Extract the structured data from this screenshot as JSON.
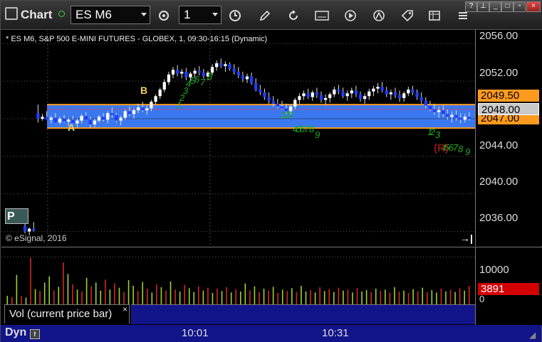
{
  "toolbar": {
    "title": "Chart",
    "symbol": "ES M6",
    "interval": "1"
  },
  "chart": {
    "header": "* ES M6, S&P 500 E-MINI FUTURES - GLOBEX, 1, 09:30-16:15 (Dynamic)",
    "copyright": "© eSignal, 2016",
    "marker_a": "A",
    "marker_b": "B",
    "marker_r": "(R)",
    "p_box": "P",
    "seq_labels": [
      "1",
      "2",
      "3",
      "4",
      "5",
      "6",
      "7",
      "8",
      "1",
      "2",
      "3",
      "4",
      "5",
      "6",
      "7",
      "8",
      "9",
      "1",
      "2",
      "3",
      "4",
      "5",
      "6",
      "7",
      "8",
      "9"
    ],
    "colors": {
      "band": "#3a78f0",
      "band_edge": "#ff9a1f",
      "up_candle": "#ffffff",
      "down_candle": "#1e3cff",
      "seq": "#1faa1f",
      "vol_up": "#9bd23a",
      "vol_down": "#d32828",
      "last_tag": "#d40000"
    },
    "candles": [
      [
        2036.6,
        2036.9,
        2035.8,
        2036.0
      ],
      [
        2036.0,
        2036.4,
        2035.6,
        2036.3
      ],
      [
        2036.3,
        2037.0,
        2036.0,
        2036.1
      ],
      [
        2048.6,
        2049.5,
        2047.6,
        2048.0
      ],
      [
        2048.0,
        2048.5,
        2047.8,
        2048.2
      ],
      [
        2048.2,
        2048.8,
        2047.9,
        2047.9
      ],
      [
        2047.9,
        2048.3,
        2047.5,
        2048.1
      ],
      [
        2048.1,
        2048.6,
        2047.8,
        2047.6
      ],
      [
        2047.6,
        2048.2,
        2047.4,
        2048.0
      ],
      [
        2048.0,
        2048.4,
        2047.6,
        2047.7
      ],
      [
        2047.7,
        2048.1,
        2047.2,
        2047.9
      ],
      [
        2047.9,
        2048.3,
        2047.4,
        2047.5
      ],
      [
        2047.5,
        2048.0,
        2047.1,
        2047.8
      ],
      [
        2047.8,
        2048.5,
        2047.5,
        2048.3
      ],
      [
        2048.3,
        2048.7,
        2047.9,
        2047.9
      ],
      [
        2047.9,
        2048.2,
        2047.0,
        2047.4
      ],
      [
        2047.4,
        2048.0,
        2047.1,
        2047.8
      ],
      [
        2047.8,
        2048.4,
        2047.6,
        2048.2
      ],
      [
        2048.2,
        2048.6,
        2047.7,
        2047.9
      ],
      [
        2047.9,
        2048.8,
        2047.5,
        2048.6
      ],
      [
        2048.6,
        2049.2,
        2048.1,
        2048.4
      ],
      [
        2048.4,
        2048.6,
        2047.6,
        2047.8
      ],
      [
        2047.8,
        2048.3,
        2047.3,
        2048.1
      ],
      [
        2048.1,
        2049.0,
        2047.9,
        2048.8
      ],
      [
        2048.8,
        2049.3,
        2048.3,
        2048.5
      ],
      [
        2048.5,
        2049.1,
        2048.0,
        2048.9
      ],
      [
        2048.9,
        2049.6,
        2048.6,
        2049.2
      ],
      [
        2049.2,
        2049.8,
        2048.7,
        2048.9
      ],
      [
        2048.9,
        2049.4,
        2048.4,
        2049.1
      ],
      [
        2049.1,
        2050.0,
        2048.8,
        2049.8
      ],
      [
        2049.8,
        2050.6,
        2049.5,
        2050.4
      ],
      [
        2050.4,
        2051.3,
        2050.1,
        2051.1
      ],
      [
        2051.1,
        2052.2,
        2050.8,
        2051.9
      ],
      [
        2051.9,
        2053.0,
        2051.6,
        2052.7
      ],
      [
        2052.7,
        2053.5,
        2052.3,
        2053.2
      ],
      [
        2053.2,
        2053.7,
        2052.5,
        2052.8
      ],
      [
        2052.8,
        2053.3,
        2052.3,
        2053.0
      ],
      [
        2053.0,
        2053.4,
        2052.1,
        2052.4
      ],
      [
        2052.4,
        2053.0,
        2052.0,
        2052.8
      ],
      [
        2052.8,
        2053.4,
        2052.4,
        2053.1
      ],
      [
        2053.1,
        2053.6,
        2052.6,
        2052.9
      ],
      [
        2052.9,
        2053.3,
        2052.3,
        2052.5
      ],
      [
        2052.5,
        2053.1,
        2052.1,
        2052.9
      ],
      [
        2052.9,
        2053.8,
        2052.6,
        2053.5
      ],
      [
        2053.5,
        2054.2,
        2053.1,
        2053.9
      ],
      [
        2053.9,
        2054.4,
        2053.4,
        2053.6
      ],
      [
        2053.6,
        2054.1,
        2053.0,
        2053.8
      ],
      [
        2053.8,
        2054.0,
        2053.1,
        2053.3
      ],
      [
        2053.3,
        2053.8,
        2052.7,
        2053.0
      ],
      [
        2053.0,
        2053.5,
        2052.3,
        2052.6
      ],
      [
        2052.6,
        2053.0,
        2051.9,
        2052.2
      ],
      [
        2052.2,
        2052.8,
        2051.8,
        2052.5
      ],
      [
        2052.5,
        2052.9,
        2051.6,
        2051.8
      ],
      [
        2051.8,
        2052.3,
        2050.9,
        2051.1
      ],
      [
        2051.1,
        2051.6,
        2050.5,
        2050.8
      ],
      [
        2050.8,
        2051.2,
        2050.0,
        2050.3
      ],
      [
        2050.3,
        2050.8,
        2049.6,
        2049.9
      ],
      [
        2049.9,
        2050.4,
        2049.3,
        2049.6
      ],
      [
        2049.6,
        2050.1,
        2049.1,
        2049.3
      ],
      [
        2049.3,
        2049.9,
        2049.0,
        2049.1
      ],
      [
        2049.1,
        2049.6,
        2048.5,
        2048.8
      ],
      [
        2048.8,
        2049.5,
        2048.4,
        2049.3
      ],
      [
        2049.3,
        2050.2,
        2049.0,
        2050.0
      ],
      [
        2050.0,
        2050.7,
        2049.6,
        2050.4
      ],
      [
        2050.4,
        2051.0,
        2050.0,
        2050.7
      ],
      [
        2050.7,
        2051.2,
        2050.1,
        2050.3
      ],
      [
        2050.3,
        2051.0,
        2049.9,
        2050.8
      ],
      [
        2050.8,
        2051.3,
        2050.2,
        2050.5
      ],
      [
        2050.5,
        2050.9,
        2049.7,
        2050.0
      ],
      [
        2050.0,
        2050.6,
        2049.5,
        2050.2
      ],
      [
        2050.2,
        2050.8,
        2049.7,
        2050.6
      ],
      [
        2050.6,
        2051.4,
        2050.3,
        2051.1
      ],
      [
        2051.1,
        2051.6,
        2050.6,
        2050.9
      ],
      [
        2050.9,
        2051.3,
        2050.2,
        2050.4
      ],
      [
        2050.4,
        2051.0,
        2049.9,
        2050.7
      ],
      [
        2050.7,
        2051.3,
        2050.2,
        2051.0
      ],
      [
        2051.0,
        2051.5,
        2050.3,
        2050.6
      ],
      [
        2050.6,
        2050.9,
        2049.8,
        2050.1
      ],
      [
        2050.1,
        2050.7,
        2049.6,
        2050.4
      ],
      [
        2050.4,
        2051.2,
        2050.0,
        2050.9
      ],
      [
        2050.9,
        2051.5,
        2050.4,
        2051.2
      ],
      [
        2051.2,
        2051.8,
        2050.7,
        2051.4
      ],
      [
        2051.4,
        2051.9,
        2050.8,
        2051.0
      ],
      [
        2051.0,
        2051.4,
        2050.3,
        2050.6
      ],
      [
        2050.6,
        2051.1,
        2050.0,
        2050.8
      ],
      [
        2050.8,
        2051.3,
        2050.2,
        2050.5
      ],
      [
        2050.5,
        2051.0,
        2049.8,
        2050.2
      ],
      [
        2050.2,
        2050.9,
        2049.8,
        2050.7
      ],
      [
        2050.7,
        2051.4,
        2050.4,
        2051.1
      ],
      [
        2051.1,
        2051.5,
        2050.5,
        2050.8
      ],
      [
        2050.8,
        2051.1,
        2050.0,
        2050.3
      ],
      [
        2050.3,
        2050.8,
        2049.6,
        2049.9
      ],
      [
        2049.9,
        2050.3,
        2049.1,
        2049.4
      ],
      [
        2049.4,
        2049.9,
        2048.8,
        2049.0
      ],
      [
        2049.0,
        2049.6,
        2048.4,
        2048.7
      ],
      [
        2048.7,
        2049.3,
        2048.1,
        2048.9
      ],
      [
        2048.9,
        2049.4,
        2048.2,
        2048.5
      ],
      [
        2048.5,
        2049.0,
        2047.9,
        2048.2
      ],
      [
        2048.2,
        2048.8,
        2047.6,
        2048.4
      ],
      [
        2048.4,
        2048.9,
        2047.8,
        2048.1
      ],
      [
        2048.1,
        2048.6,
        2047.5,
        2047.9
      ],
      [
        2047.9,
        2048.5,
        2047.6,
        2048.2
      ],
      [
        2048.2,
        2048.7,
        2047.8,
        2048.0
      ]
    ],
    "volumes": [
      1800,
      1500,
      6200,
      1700,
      1400,
      9800,
      3200,
      2800,
      4600,
      5900,
      2900,
      3700,
      8800,
      6400,
      4200,
      3100,
      2700,
      5600,
      3800,
      4600,
      2900,
      5200,
      3100,
      4400,
      3500,
      2600,
      5100,
      3900,
      2800,
      4700,
      3300,
      2500,
      4200,
      3600,
      2900,
      4800,
      3100,
      2700,
      4100,
      3400,
      2600,
      3800,
      2900,
      3500,
      2400,
      3300,
      2800,
      3600,
      2500,
      3200,
      2700,
      4400,
      2900,
      3800,
      2600,
      3300,
      2900,
      3700,
      2400,
      3100,
      2800,
      3400,
      2600,
      3900,
      2700,
      3000,
      2500,
      3600,
      2800,
      3200,
      2600,
      3500,
      2900,
      3100,
      2500,
      3400,
      2700,
      3000,
      2600,
      3300,
      2800,
      3100,
      2500,
      3600,
      2700,
      2900,
      2400,
      3200,
      2800,
      3500,
      2600,
      3000,
      2500,
      3300,
      2700,
      3100,
      2600,
      3400,
      2900,
      3891
    ],
    "vol_up": [
      1,
      0,
      1,
      0,
      1,
      0,
      1,
      0,
      1,
      1,
      0,
      1,
      0,
      1,
      0,
      1,
      0,
      1,
      0,
      1,
      1,
      0,
      1,
      0,
      1,
      0,
      1,
      1,
      0,
      1,
      0,
      1,
      0,
      1,
      0,
      1,
      0,
      1,
      0,
      1,
      1,
      0,
      1,
      0,
      1,
      0,
      1,
      0,
      1,
      0,
      1,
      1,
      0,
      1,
      0,
      1,
      0,
      1,
      0,
      1,
      0,
      1,
      0,
      1,
      1,
      0,
      1,
      0,
      1,
      0,
      1,
      0,
      1,
      0,
      1,
      0,
      1,
      1,
      0,
      1,
      0,
      1,
      0,
      1,
      0,
      1,
      0,
      1,
      0,
      1,
      0,
      1,
      1,
      0,
      1,
      0,
      1,
      0,
      1,
      0
    ],
    "price_range": [
      2034.0,
      2057.0
    ],
    "vol_range": [
      0,
      12000
    ]
  },
  "axis": {
    "labels": [
      "2056.00",
      "2052.00",
      "2049.50",
      "2048.00",
      "2047.00",
      "2044.00",
      "2040.00",
      "2036.00"
    ],
    "vol_labels": [
      "10000",
      "3891",
      "0"
    ]
  },
  "study": {
    "label": "Vol (current price bar)",
    "close": "×"
  },
  "time": {
    "labels": [
      "10:01",
      "10:31"
    ],
    "dyn": "Dyn"
  }
}
